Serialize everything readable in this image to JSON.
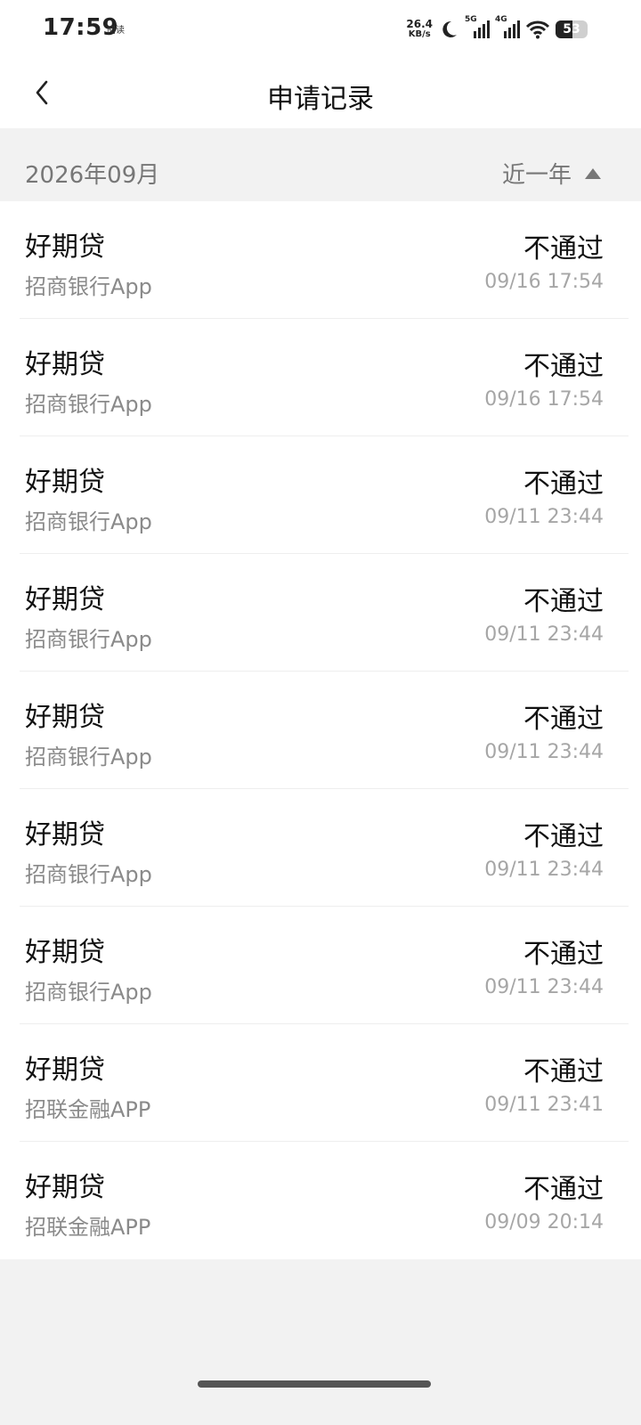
{
  "status_bar": {
    "time": "17:59",
    "app_label": "阅读",
    "net_speed_value": "26.4",
    "net_speed_unit": "KB/s",
    "sim1_label": "5G",
    "sim2_label": "4G",
    "battery_level": "53"
  },
  "header": {
    "title": "申请记录",
    "back_icon": "chevron-left-icon"
  },
  "filter": {
    "month": "2026年09月",
    "range_label": "近一年",
    "range_icon": "triangle-up-icon"
  },
  "records": [
    {
      "product": "好期贷",
      "source": "招商银行App",
      "status": "不通过",
      "time": "09/16 17:54"
    },
    {
      "product": "好期贷",
      "source": "招商银行App",
      "status": "不通过",
      "time": "09/16 17:54"
    },
    {
      "product": "好期贷",
      "source": "招商银行App",
      "status": "不通过",
      "time": "09/11 23:44"
    },
    {
      "product": "好期贷",
      "source": "招商银行App",
      "status": "不通过",
      "time": "09/11 23:44"
    },
    {
      "product": "好期贷",
      "source": "招商银行App",
      "status": "不通过",
      "time": "09/11 23:44"
    },
    {
      "product": "好期贷",
      "source": "招商银行App",
      "status": "不通过",
      "time": "09/11 23:44"
    },
    {
      "product": "好期贷",
      "source": "招商银行App",
      "status": "不通过",
      "time": "09/11 23:44"
    },
    {
      "product": "好期贷",
      "source": "招联金融APP",
      "status": "不通过",
      "time": "09/11 23:41"
    },
    {
      "product": "好期贷",
      "source": "招联金融APP",
      "status": "不通过",
      "time": "09/09 20:14"
    }
  ]
}
